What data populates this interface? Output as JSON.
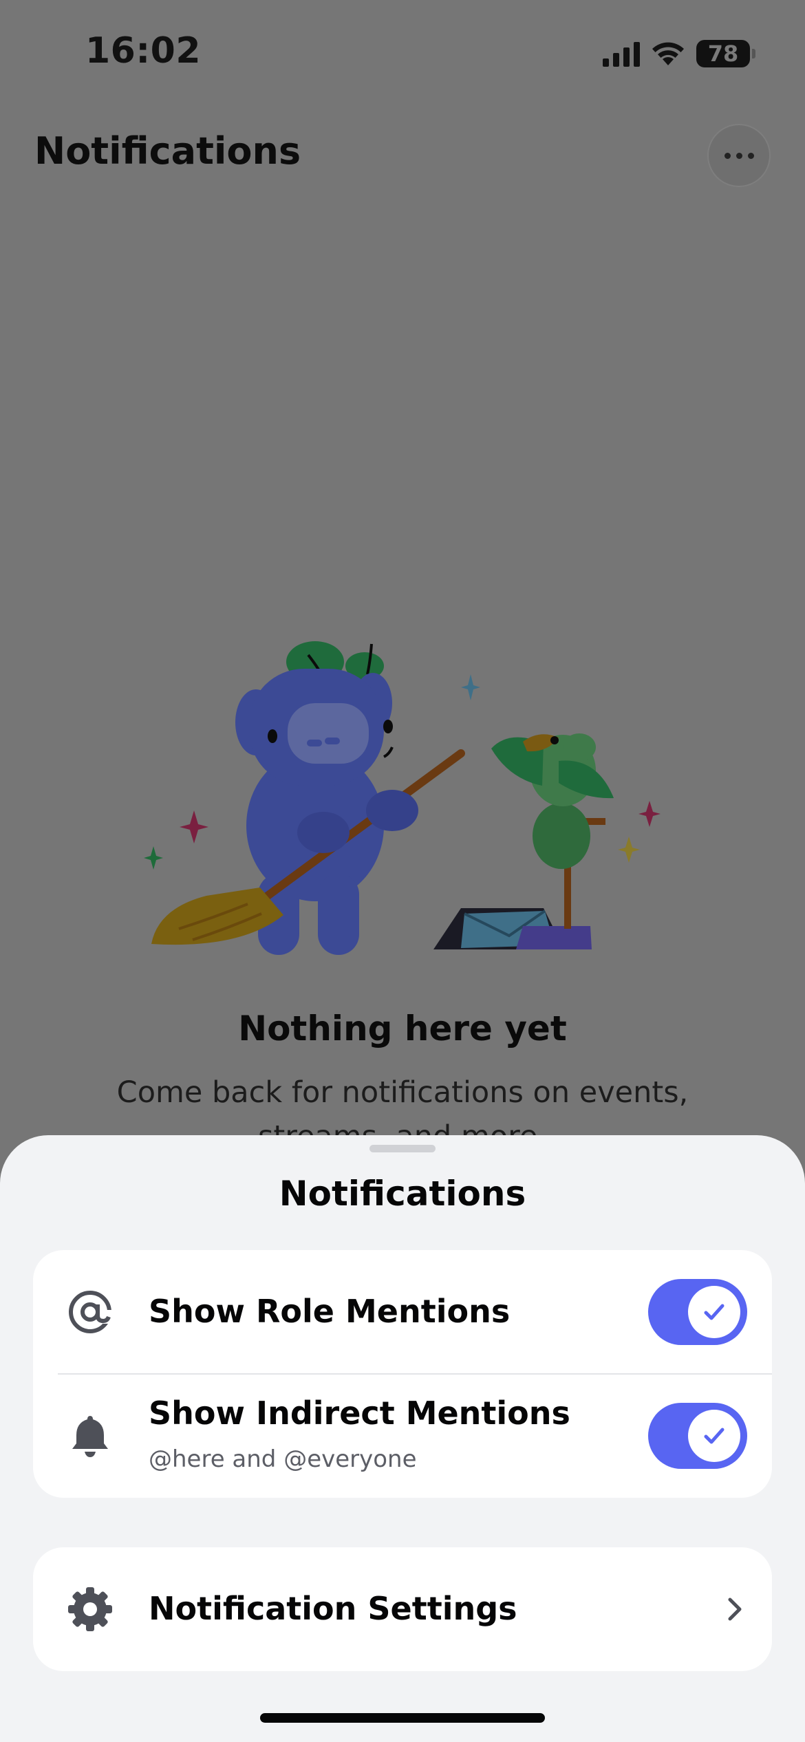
{
  "status_bar": {
    "time": "16:02",
    "battery": "78",
    "icons": [
      "signal-icon",
      "wifi-icon",
      "battery-icon"
    ]
  },
  "header": {
    "title": "Notifications",
    "more_icon": "ellipsis-icon"
  },
  "empty_state": {
    "title": "Nothing here yet",
    "subtitle": "Come back for notifications on events, streams, and more."
  },
  "sheet": {
    "title": "Notifications",
    "mention_settings": [
      {
        "icon": "at-icon",
        "label": "Show Role Mentions",
        "sublabel": "",
        "enabled": true
      },
      {
        "icon": "bell-icon",
        "label": "Show Indirect Mentions",
        "sublabel": "@here and @everyone",
        "enabled": true
      }
    ],
    "settings_link": {
      "icon": "gear-icon",
      "label": "Notification Settings",
      "chevron": "chevron-right-icon"
    }
  },
  "colors": {
    "accent": "#5865f2",
    "sheet_background": "#f2f3f5",
    "card_background": "#ffffff",
    "dimmed_background": "#767676"
  }
}
